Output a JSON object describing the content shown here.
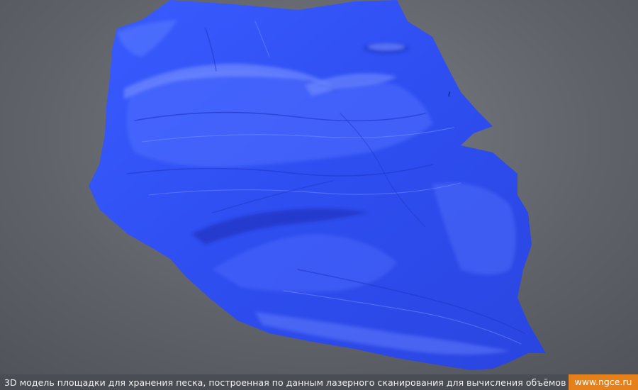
{
  "scene": {
    "background_color": "#5f6269",
    "model_color": "#2f4ff2",
    "model_highlight_color": "#5f7cff",
    "model_shadow_color": "#1a2fb8",
    "object": "laser-scan-surface-model"
  },
  "footer": {
    "caption": "3D модель площадки для хранения песка, построенная по данным лазерного сканирования для вычисления объёмов",
    "site": "www.ngce.ru",
    "site_badge_color": "#e6801a"
  }
}
